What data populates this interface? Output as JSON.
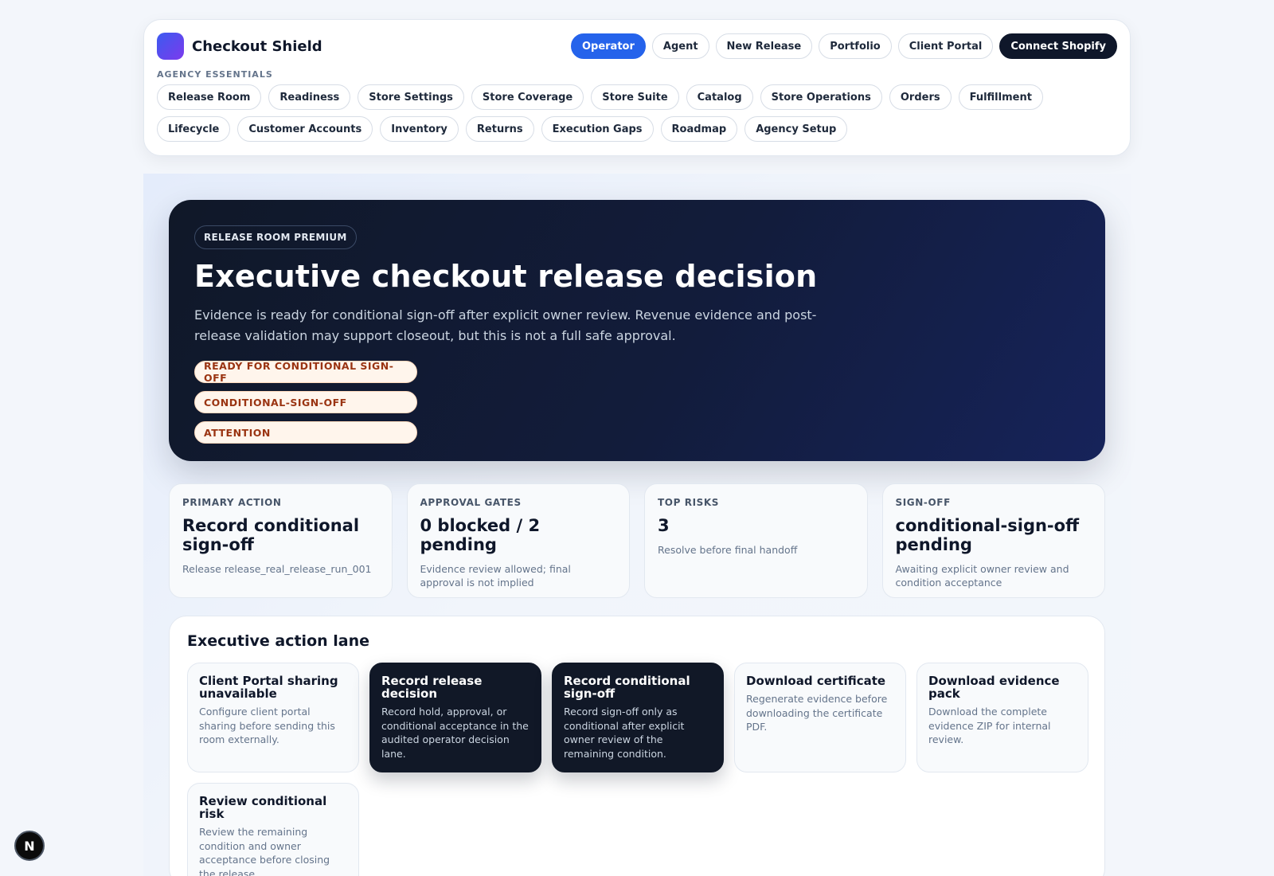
{
  "brand": {
    "name": "Checkout Shield"
  },
  "nav": {
    "buttons": [
      {
        "label": "Operator",
        "style": "primary"
      },
      {
        "label": "Agent",
        "style": "default"
      },
      {
        "label": "New Release",
        "style": "default"
      },
      {
        "label": "Portfolio",
        "style": "default"
      },
      {
        "label": "Client Portal",
        "style": "default"
      },
      {
        "label": "Connect Shopify",
        "style": "dark"
      }
    ]
  },
  "essentials": {
    "label": "AGENCY ESSENTIALS",
    "items": [
      "Release Room",
      "Readiness",
      "Store Settings",
      "Store Coverage",
      "Store Suite",
      "Catalog",
      "Store Operations",
      "Orders",
      "Fulfillment",
      "Lifecycle",
      "Customer Accounts",
      "Inventory",
      "Returns",
      "Execution Gaps",
      "Roadmap",
      "Agency Setup"
    ]
  },
  "hero": {
    "badge": "RELEASE ROOM PREMIUM",
    "title": "Executive checkout release decision",
    "description": "Evidence is ready for conditional sign-off after explicit owner review. Revenue evidence and post-release validation may support closeout, but this is not a full safe approval.",
    "tags": [
      "READY FOR CONDITIONAL SIGN-OFF",
      "CONDITIONAL-SIGN-OFF",
      "ATTENTION"
    ]
  },
  "metrics": [
    {
      "label": "PRIMARY ACTION",
      "value": "Record conditional sign-off",
      "note": "Release release_real_release_run_001"
    },
    {
      "label": "APPROVAL GATES",
      "value": "0 blocked / 2 pending",
      "note": "Evidence review allowed; final approval is not implied"
    },
    {
      "label": "TOP RISKS",
      "value": "3",
      "note": "Resolve before final handoff"
    },
    {
      "label": "SIGN-OFF",
      "value": "conditional-sign-off pending",
      "note": "Awaiting explicit owner review and condition acceptance"
    }
  ],
  "lane": {
    "title": "Executive action lane",
    "cards": [
      {
        "title": "Client Portal sharing unavailable",
        "description": "Configure client portal sharing before sending this room externally.",
        "dark": false
      },
      {
        "title": "Record release decision",
        "description": "Record hold, approval, or conditional acceptance in the audited operator decision lane.",
        "dark": true
      },
      {
        "title": "Record conditional sign-off",
        "description": "Record sign-off only as conditional after explicit owner review of the remaining condition.",
        "dark": true
      },
      {
        "title": "Download certificate",
        "description": "Regenerate evidence before downloading the certificate PDF.",
        "dark": false
      },
      {
        "title": "Download evidence pack",
        "description": "Download the complete evidence ZIP for internal review.",
        "dark": false
      },
      {
        "title": "Review conditional risk",
        "description": "Review the remaining condition and owner acceptance before closing the release.",
        "dark": false
      }
    ]
  },
  "floating_badge": {
    "letter": "N"
  }
}
